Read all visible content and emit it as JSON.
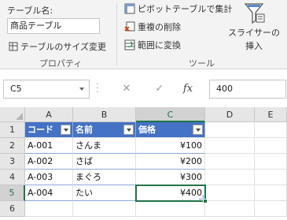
{
  "ribbon": {
    "table_name_label": "テーブル名:",
    "table_name_value": "商品テーブル",
    "resize_label": "テーブルのサイズ変更",
    "properties_group": "プロパティ",
    "pivot_label": "ピボットテーブルで集計",
    "remove_duplicates_label": "重複の削除",
    "convert_to_range_label": "範囲に変換",
    "tools_group": "ツール",
    "slicer_label_line1": "スライサーの",
    "slicer_label_line2": "挿入"
  },
  "formula_bar": {
    "name_box": "C5",
    "cancel_symbol": "✕",
    "enter_symbol": "✓",
    "fx_symbol": "fx",
    "value": "400"
  },
  "grid": {
    "columns": [
      "A",
      "B",
      "C",
      "D",
      "E"
    ],
    "rows": [
      "1",
      "2",
      "3",
      "4",
      "5",
      "6"
    ],
    "active_column": "C",
    "active_row": "5",
    "header": [
      "コード",
      "名前",
      "価格"
    ],
    "data": [
      [
        "A-001",
        "さんま",
        "¥100"
      ],
      [
        "A-002",
        "さば",
        "¥200"
      ],
      [
        "A-003",
        "まぐろ",
        "¥300"
      ],
      [
        "A-004",
        "たい",
        "¥400"
      ]
    ]
  },
  "colors": {
    "accent": "#217346",
    "table_header": "#4472c4",
    "table_band_line": "#8ea9db"
  }
}
